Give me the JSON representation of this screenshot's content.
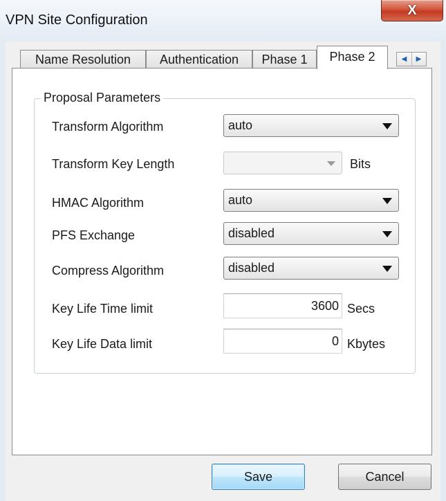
{
  "window": {
    "title": "VPN Site Configuration",
    "close_glyph": "X"
  },
  "tabs": [
    {
      "label": "Name Resolution",
      "active": false
    },
    {
      "label": "Authentication",
      "active": false
    },
    {
      "label": "Phase 1",
      "active": false
    },
    {
      "label": "Phase 2",
      "active": true
    }
  ],
  "tab_scroll": {
    "left": "◀",
    "right": "▶"
  },
  "group": {
    "title": "Proposal Parameters"
  },
  "fields": {
    "transform_algorithm": {
      "label": "Transform Algorithm",
      "value": "auto"
    },
    "transform_key_length": {
      "label": "Transform Key Length",
      "value": "",
      "unit": "Bits",
      "disabled": true
    },
    "hmac_algorithm": {
      "label": "HMAC Algorithm",
      "value": "auto"
    },
    "pfs_exchange": {
      "label": "PFS Exchange",
      "value": "disabled"
    },
    "compress_algorithm": {
      "label": "Compress Algorithm",
      "value": "disabled"
    },
    "key_life_time": {
      "label": "Key Life Time limit",
      "value": "3600",
      "unit": "Secs"
    },
    "key_life_data": {
      "label": "Key Life Data limit",
      "value": "0",
      "unit": "Kbytes"
    }
  },
  "buttons": {
    "save": "Save",
    "cancel": "Cancel"
  }
}
